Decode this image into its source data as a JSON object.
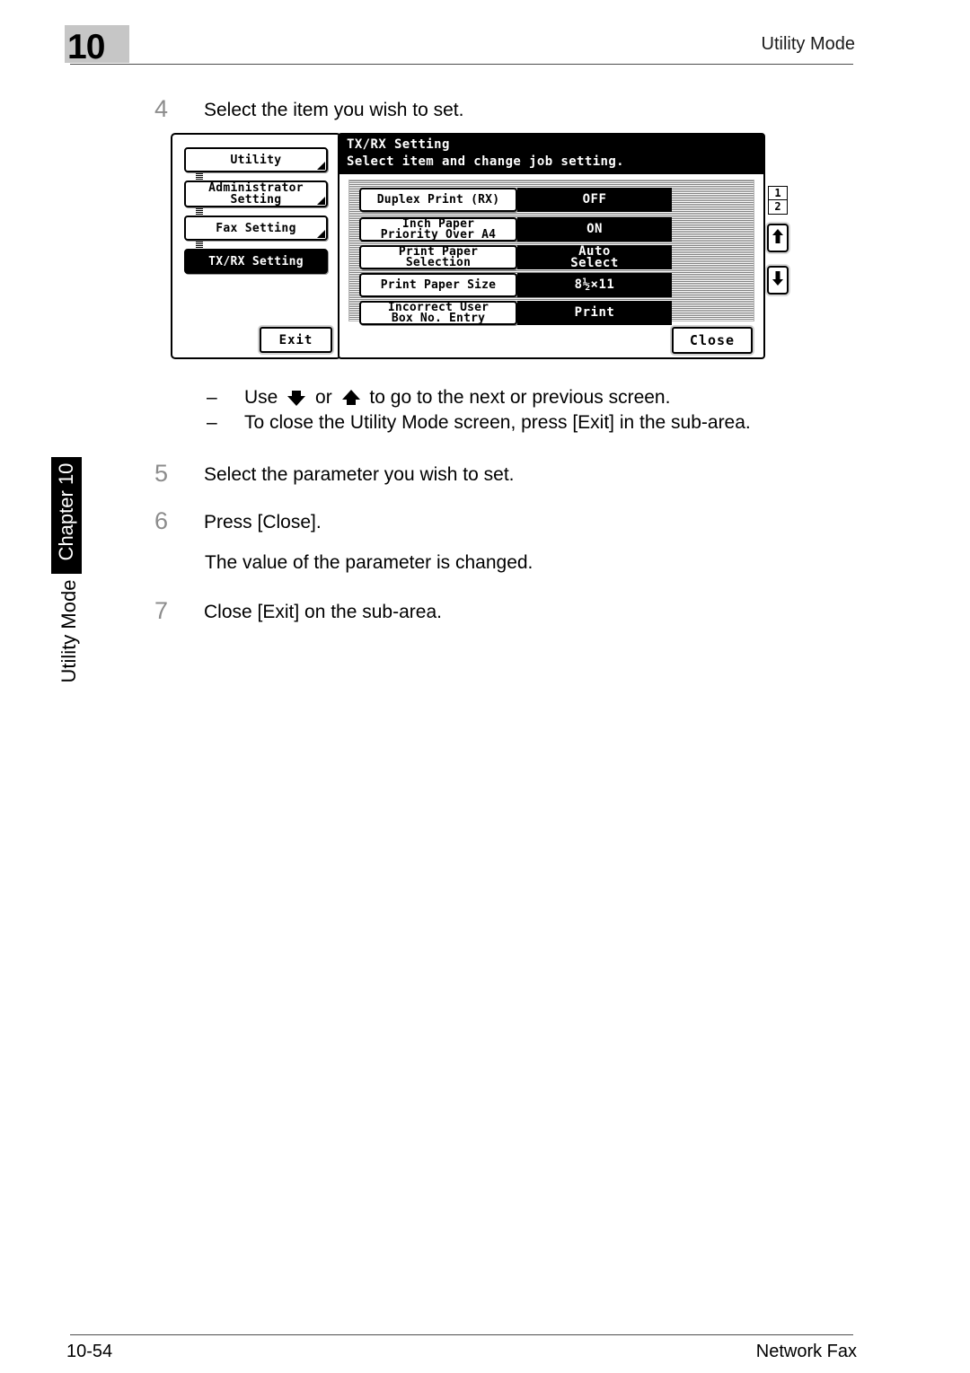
{
  "header": {
    "chapter_number": "10",
    "title": "Utility Mode"
  },
  "side_tab": {
    "chapter_label": "Chapter 10",
    "section_label": "Utility Mode"
  },
  "steps": [
    {
      "number": "4",
      "text": "Select the item you wish to set."
    },
    {
      "number": "5",
      "text": "Select the parameter you wish to set."
    },
    {
      "number": "6",
      "text": "Press [Close].",
      "note": "The value of the parameter is changed."
    },
    {
      "number": "7",
      "text": "Close [Exit] on the sub-area."
    }
  ],
  "notes": [
    {
      "dash": "–",
      "before": "Use",
      "mid": "or",
      "after": "to go to the next or previous screen."
    },
    {
      "dash": "–",
      "text": "To close the Utility Mode screen, press [Exit] in the sub-area."
    }
  ],
  "lcd": {
    "title": "TX/RX Setting",
    "subtitle": "Select item and change job setting.",
    "sidebar": {
      "items": [
        {
          "label": "Utility",
          "selected": false
        },
        {
          "label": "Administrator\nSetting",
          "selected": false
        },
        {
          "label": "Fax Setting",
          "selected": false
        },
        {
          "label": "TX/RX Setting",
          "selected": true
        }
      ],
      "exit_label": "Exit"
    },
    "settings": [
      {
        "label": "Duplex Print (RX)",
        "value": "OFF"
      },
      {
        "label": "Inch Paper\nPriority Over A4",
        "value": "ON"
      },
      {
        "label": "Print Paper\nSelection",
        "value": "Auto\nSelect"
      },
      {
        "label": "Print Paper Size",
        "value": "8½×11"
      },
      {
        "label": "Incorrect User\nBox No. Entry",
        "value": "Print"
      }
    ],
    "pagination": {
      "current": "1",
      "total": "2"
    },
    "scroll_up_icon": "arrow-up-icon",
    "scroll_down_icon": "arrow-down-icon",
    "close_label": "Close"
  },
  "footer": {
    "page": "10-54",
    "document": "Network Fax"
  },
  "colors": {
    "badge_gray": "#c6c6c6",
    "step_number_gray": "#8c8c8c",
    "ink_black": "#000000"
  }
}
